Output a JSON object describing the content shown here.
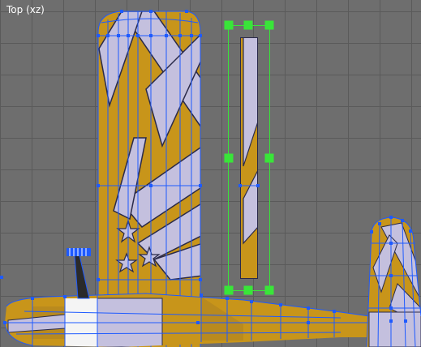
{
  "viewport": {
    "label": "Top (xz)",
    "colors": {
      "background": "#6e6e6e",
      "grid": "#5a5a5a",
      "wire": "#1e5aff",
      "selection": "#39e539",
      "tex_gold": "#c8951a",
      "tex_lilac": "#c4c0de",
      "tex_edge": "#2a2a4a"
    }
  }
}
